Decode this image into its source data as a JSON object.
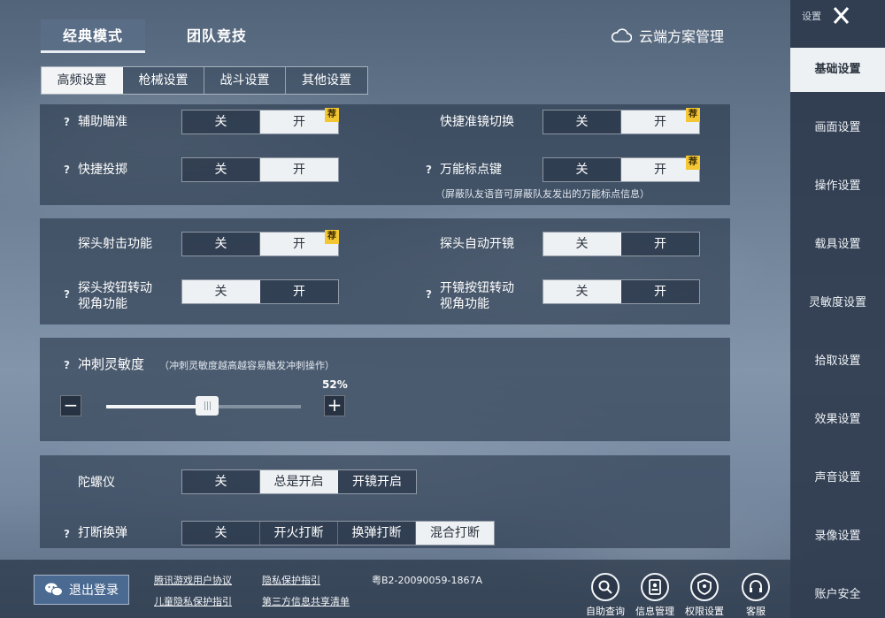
{
  "mode_tabs": [
    "经典模式",
    "团队竞技"
  ],
  "cloud_manage": "云端方案管理",
  "sub_tabs": [
    "高频设置",
    "枪械设置",
    "战斗设置",
    "其他设置"
  ],
  "toggle_off": "关",
  "toggle_on": "开",
  "badge": "荐",
  "panel1": {
    "aim_assist": "辅助瞄准",
    "quick_scope_switch": "快捷准镜切换",
    "quick_throw": "快捷投掷",
    "universal_mark": "万能标点键",
    "universal_mark_note": "（屏蔽队友语音可屏蔽队友发出的万能标点信息）"
  },
  "panel2": {
    "peek_fire": "探头射击功能",
    "peek_auto_scope": "探头自动开镜",
    "peek_button_rotate_1": "探头按钮转动",
    "peek_button_rotate_2": "视角功能",
    "scope_button_rotate_1": "开镜按钮转动",
    "scope_button_rotate_2": "视角功能"
  },
  "panel3": {
    "sprint_sensitivity": "冲刺灵敏度",
    "sprint_note": "（冲刺灵敏度越高越容易触发冲刺操作）",
    "value_label": "52%",
    "value": 0.52,
    "minus": "−",
    "plus": "+"
  },
  "panel4": {
    "gyro": "陀螺仪",
    "gyro_options": [
      "关",
      "总是开启",
      "开镜开启"
    ],
    "interrupt_reload": "打断换弹",
    "interrupt_options": [
      "关",
      "开火打断",
      "换弹打断",
      "混合打断"
    ]
  },
  "footer": {
    "logout": "退出登录",
    "user_agreement": "腾讯游戏用户协议",
    "privacy_guide": "隐私保护指引",
    "license": "粤B2-20090059-1867A",
    "child_privacy": "儿童隐私保护指引",
    "third_party": "第三方信息共享清单",
    "icons": [
      "自助查询",
      "信息管理",
      "权限设置",
      "客服"
    ]
  },
  "sidebar": {
    "header": "设置",
    "items": [
      "基础设置",
      "画面设置",
      "操作设置",
      "载具设置",
      "灵敏度设置",
      "拾取设置",
      "效果设置",
      "声音设置",
      "录像设置",
      "账户安全"
    ]
  }
}
